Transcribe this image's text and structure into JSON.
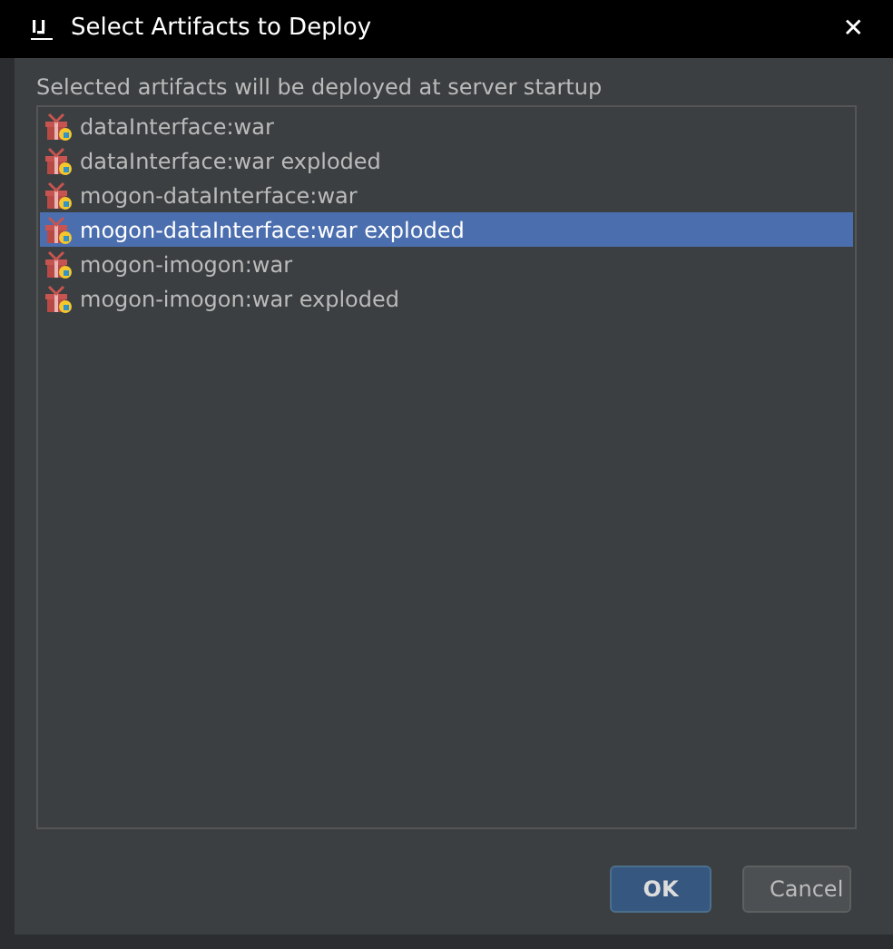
{
  "window": {
    "title": "Select Artifacts to Deploy",
    "close": "✕"
  },
  "label": "Selected artifacts will be deployed at server startup",
  "artifacts": [
    {
      "name": "dataInterface:war",
      "selected": false
    },
    {
      "name": "dataInterface:war exploded",
      "selected": false
    },
    {
      "name": "mogon-dataInterface:war",
      "selected": false
    },
    {
      "name": "mogon-dataInterface:war exploded",
      "selected": true
    },
    {
      "name": "mogon-imogon:war",
      "selected": false
    },
    {
      "name": "mogon-imogon:war exploded",
      "selected": false
    }
  ],
  "buttons": [
    {
      "label": "OK",
      "kind": "primary"
    },
    {
      "label": "Cancel",
      "kind": "secondary"
    }
  ]
}
